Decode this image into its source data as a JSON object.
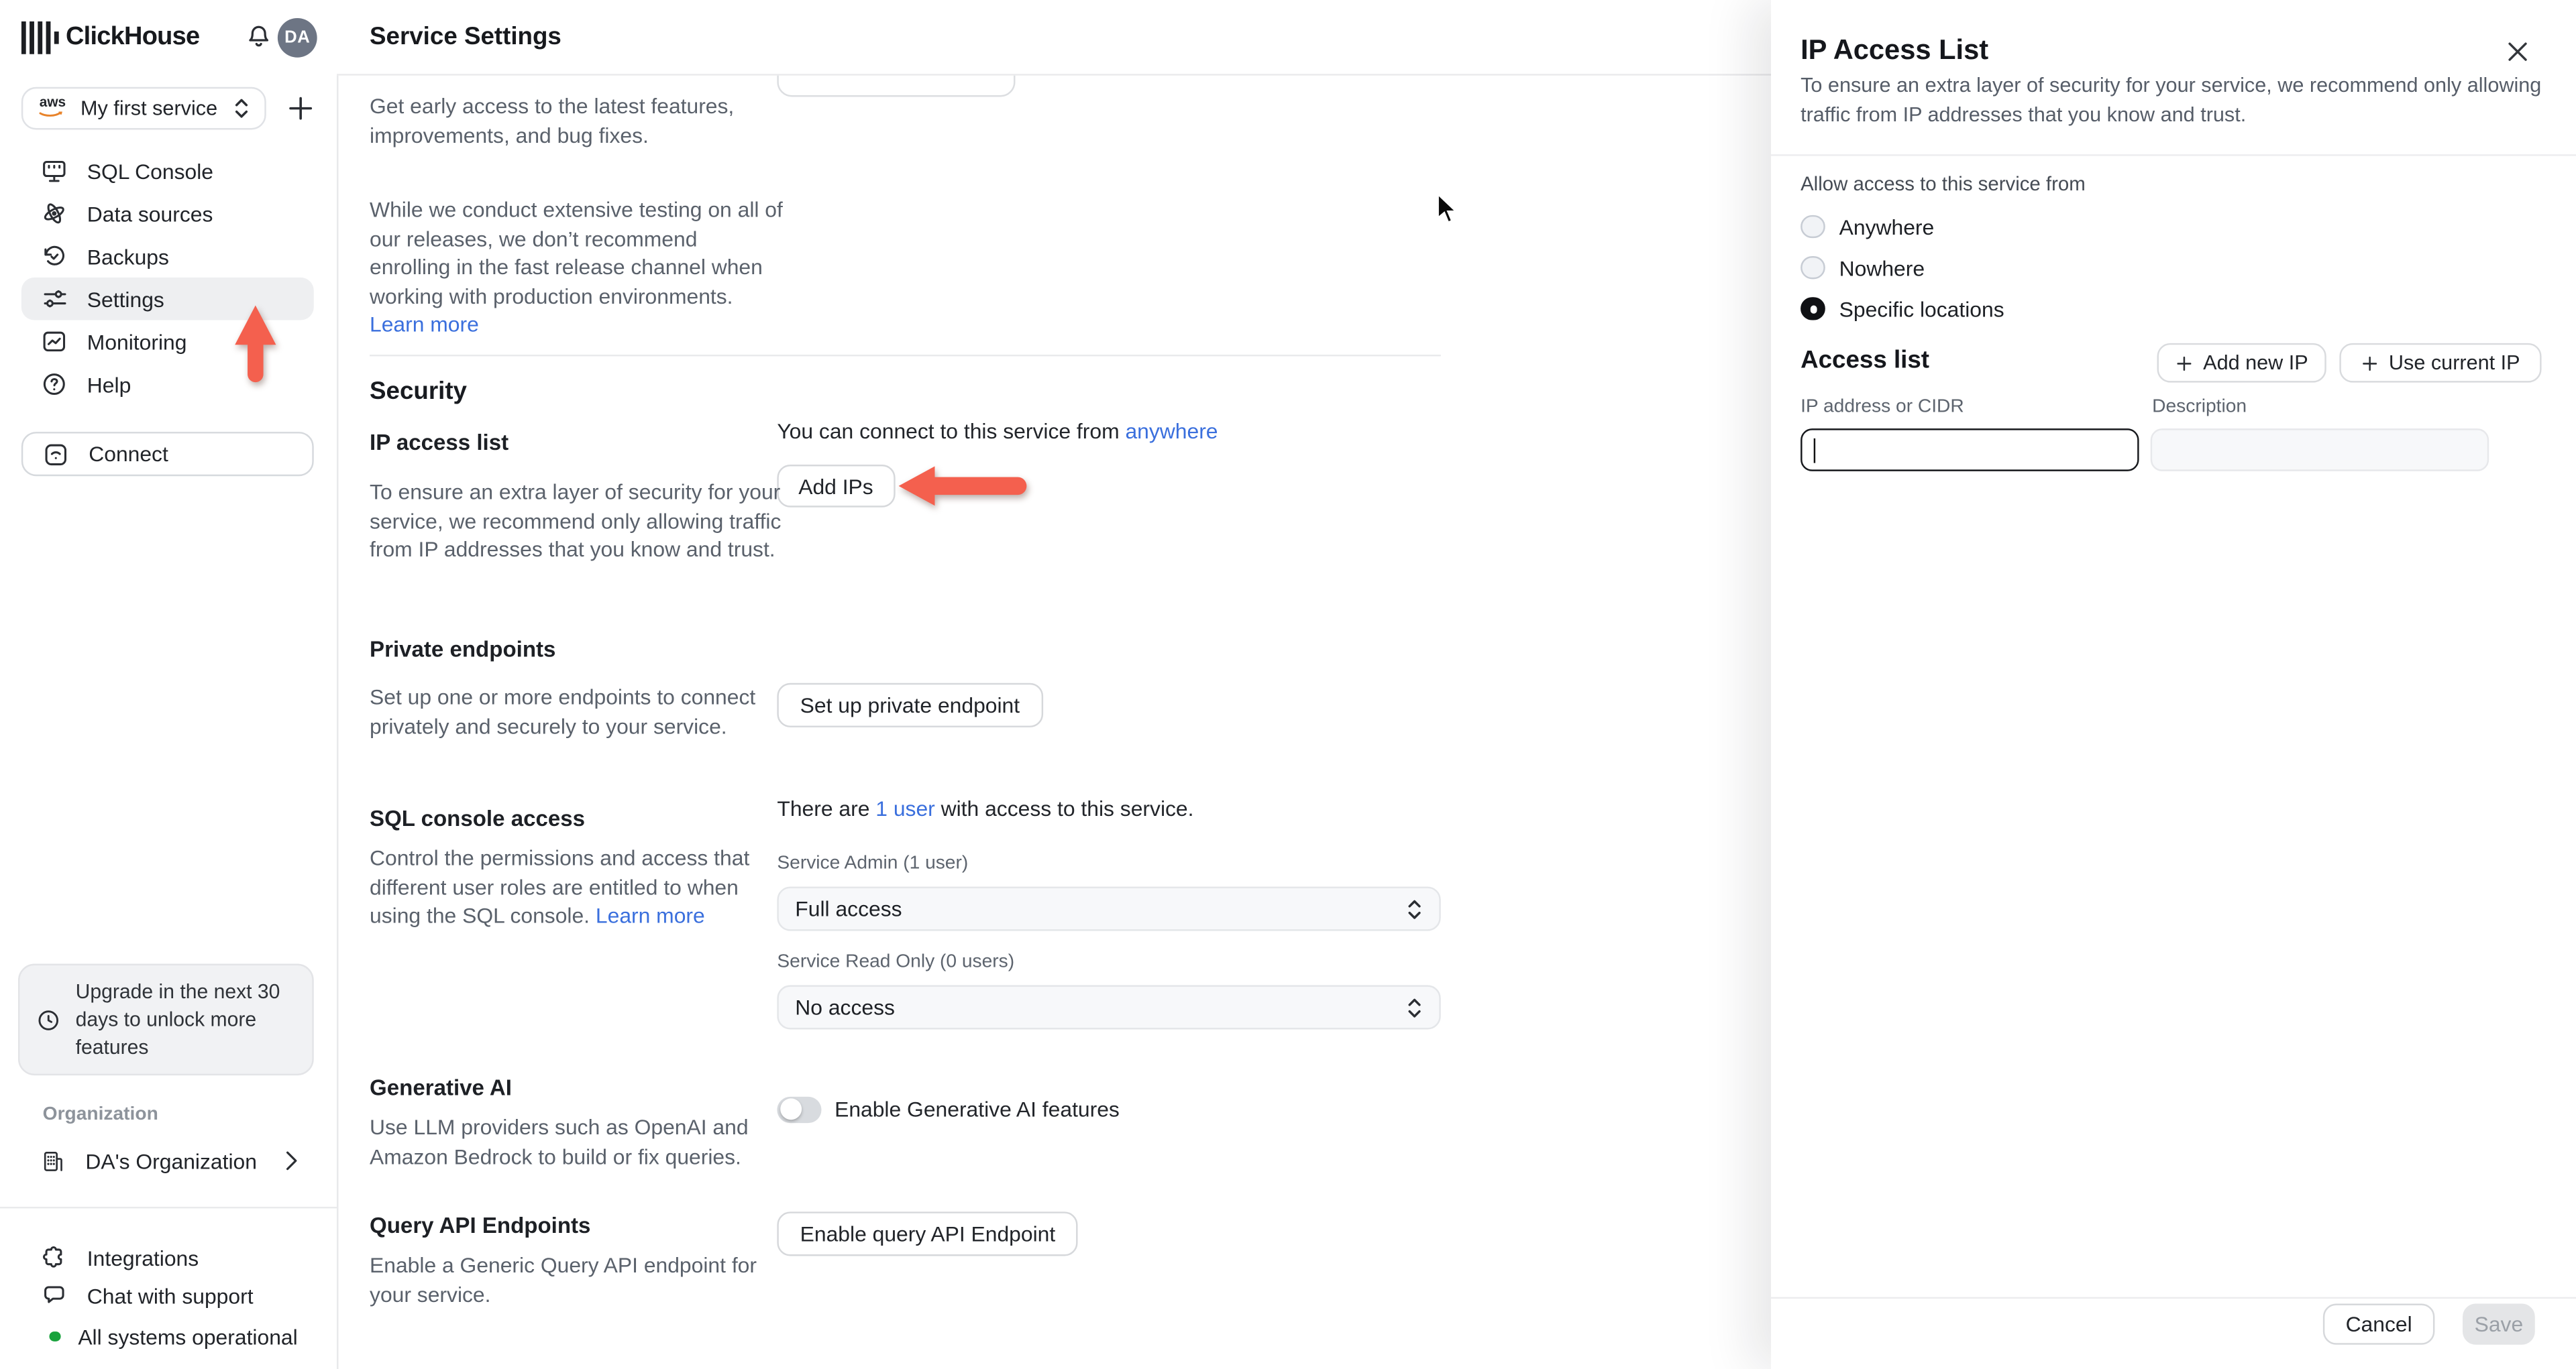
{
  "app": {
    "brand": "ClickHouse"
  },
  "colors": {
    "accent_link": "#3a6fdd",
    "annotation_arrow": "#f4604e",
    "status_ok_green": "#18a23c",
    "aws_orange": "#e8832a",
    "selected_nav_bg": "#eeeff1",
    "disabled_button_bg": "#e4e5e7"
  },
  "icons": {
    "logo": "clickhouse-bars",
    "notifications": "bell",
    "service_cloud": "aws",
    "nav": [
      "terminal-monitor",
      "orbit",
      "history-clock",
      "sliders",
      "line-chart",
      "question-circle"
    ],
    "connect": "wifi-square",
    "upgrade": "clock",
    "organization": "building",
    "integrations": "puzzle",
    "chat": "speech-bubble"
  },
  "sidebar": {
    "avatar": "DA",
    "service": "My first service",
    "provider": "aws",
    "nav": [
      {
        "label": "SQL Console"
      },
      {
        "label": "Data sources"
      },
      {
        "label": "Backups"
      },
      {
        "label": "Settings",
        "selected": true
      },
      {
        "label": "Monitoring"
      },
      {
        "label": "Help"
      }
    ],
    "connect": "Connect",
    "upgrade": "Upgrade in the next 30 days to unlock more features",
    "org_label": "Organization",
    "org_name": "DA's Organization",
    "integrations": "Integrations",
    "chat": "Chat with support",
    "status": "All systems operational"
  },
  "header": {
    "title": "Service Settings"
  },
  "main": {
    "fast_release": {
      "para1": "Get early access to the latest features, improvements, and bug fixes.",
      "para2": "While we conduct extensive testing on all of our releases, we don’t recommend enrolling in the fast release channel when working with production environments.",
      "learn_more": "Learn more"
    },
    "security": {
      "heading": "Security",
      "ip_access_list": {
        "title": "IP access list",
        "description": "To ensure an extra layer of security for your service, we recommend only allowing traffic from IP addresses that you know and trust.",
        "status_prefix": "You can connect to this service from ",
        "status_link": "anywhere",
        "button": "Add IPs"
      },
      "private_endpoints": {
        "title": "Private endpoints",
        "description": "Set up one or more endpoints to connect privately and securely to your service.",
        "button": "Set up private endpoint"
      },
      "sql_console_access": {
        "title": "SQL console access",
        "description": "Control the permissions and access that different user roles are entitled to when using the SQL console.",
        "learn_more": "Learn more",
        "status_prefix": "There are ",
        "status_link": "1 user",
        "status_suffix": " with access to this service.",
        "admin_label": "Service Admin (1 user)",
        "admin_value": "Full access",
        "readonly_label": "Service Read Only (0 users)",
        "readonly_value": "No access"
      },
      "generative_ai": {
        "title": "Generative AI",
        "description": "Use LLM providers such as OpenAI and Amazon Bedrock to build or fix queries.",
        "toggle_label": "Enable Generative AI features",
        "toggle_state": "off"
      },
      "query_api": {
        "title": "Query API Endpoints",
        "description": "Enable a Generic Query API endpoint for your service.",
        "button": "Enable query API Endpoint"
      }
    }
  },
  "panel": {
    "title": "IP Access List",
    "description": "To ensure an extra layer of security for your service, we recommend only allowing traffic from IP addresses that you know and trust.",
    "allow_label": "Allow access to this service from",
    "options": [
      {
        "label": "Anywhere",
        "selected": false
      },
      {
        "label": "Nowhere",
        "selected": false
      },
      {
        "label": "Specific locations",
        "selected": true
      }
    ],
    "access_list": {
      "heading": "Access list",
      "add_new_ip": "Add new IP",
      "use_current_ip": "Use current IP",
      "ip_label": "IP address or CIDR",
      "desc_label": "Description",
      "ip_value": "",
      "desc_value": ""
    },
    "footer": {
      "cancel": "Cancel",
      "save": "Save"
    }
  }
}
